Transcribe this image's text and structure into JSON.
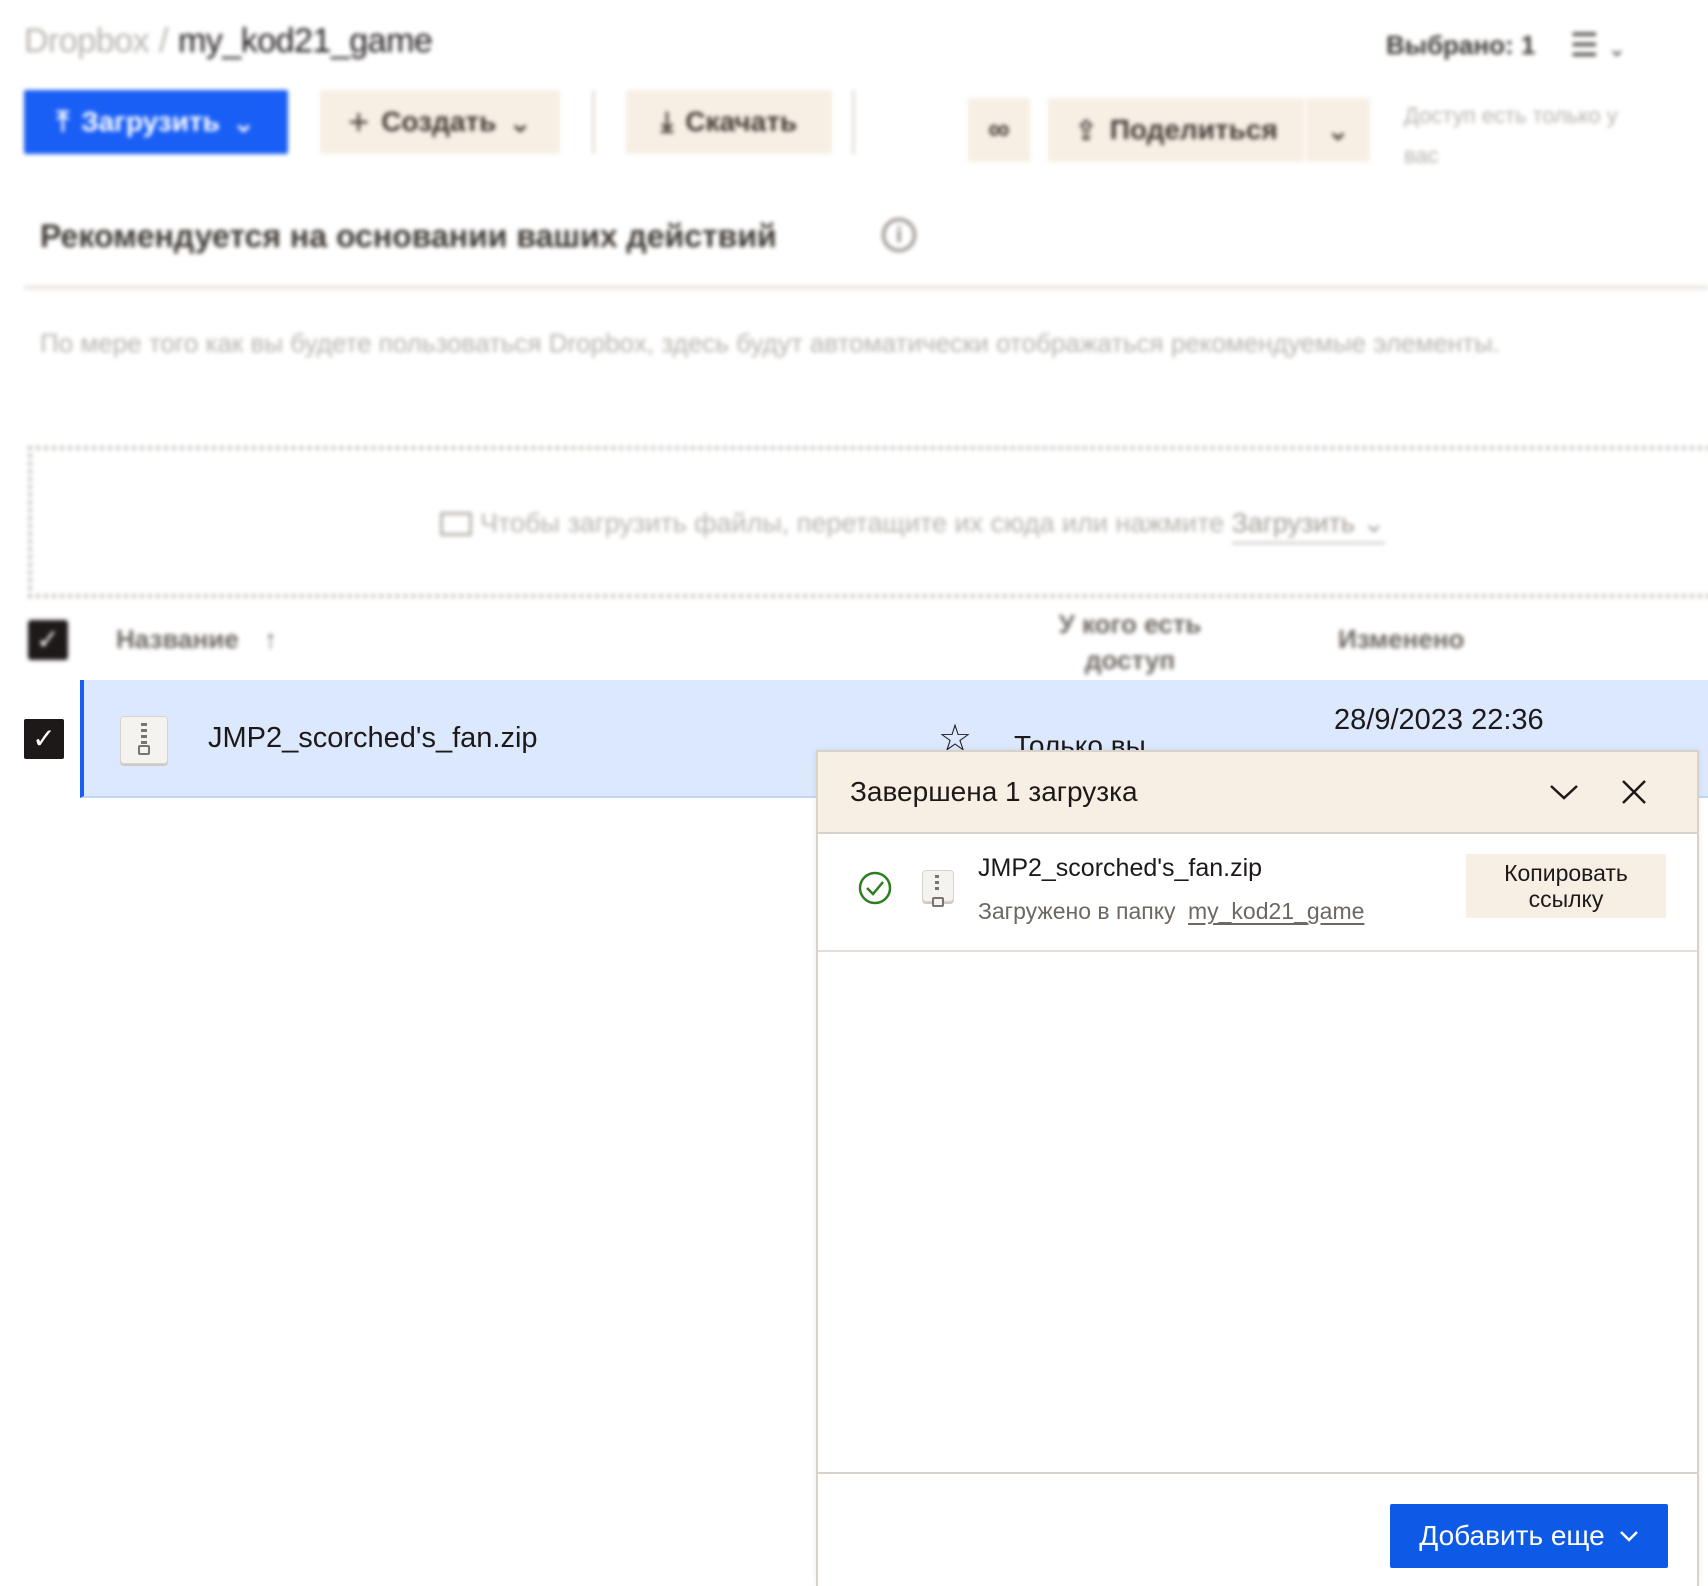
{
  "breadcrumb": {
    "root": "Dropbox",
    "separator": "/",
    "current": "my_kod21_game"
  },
  "header": {
    "selected_label": "Выбрано: 1",
    "view_icon": "list-view-icon"
  },
  "toolbar": {
    "upload_label": "Загрузить",
    "create_label": "Создать",
    "download_label": "Скачать",
    "share_label": "Поделиться",
    "access_note": "Доступ есть только у вас"
  },
  "suggested": {
    "title": "Рекомендуется на основании ваших действий",
    "description": "По мере того как вы будете пользоваться Dropbox, здесь будут автоматически отображаться рекомендуемые элементы."
  },
  "dropzone": {
    "text": "Чтобы загрузить файлы, перетащите их сюда или нажмите",
    "link": "Загрузить"
  },
  "table": {
    "headers": {
      "name": "Название",
      "access": "У кого есть доступ",
      "modified": "Изменено"
    },
    "rows": [
      {
        "name": "JMP2_scorched's_fan.zip",
        "access": "Только вы",
        "modified": "28/9/2023 22:36"
      }
    ]
  },
  "upload_panel": {
    "title": "Завершена 1 загрузка",
    "items": [
      {
        "name": "JMP2_scorched's_fan.zip",
        "status": "Загружено в папку",
        "folder": "my_kod21_game",
        "copy_label": "Копировать ссылку"
      }
    ],
    "add_more_label": "Добавить еще"
  },
  "colors": {
    "accent": "#0D5AE6",
    "selection": "#DBE8FD",
    "panel_header": "#F7EFE4",
    "success": "#2E7D1F"
  }
}
